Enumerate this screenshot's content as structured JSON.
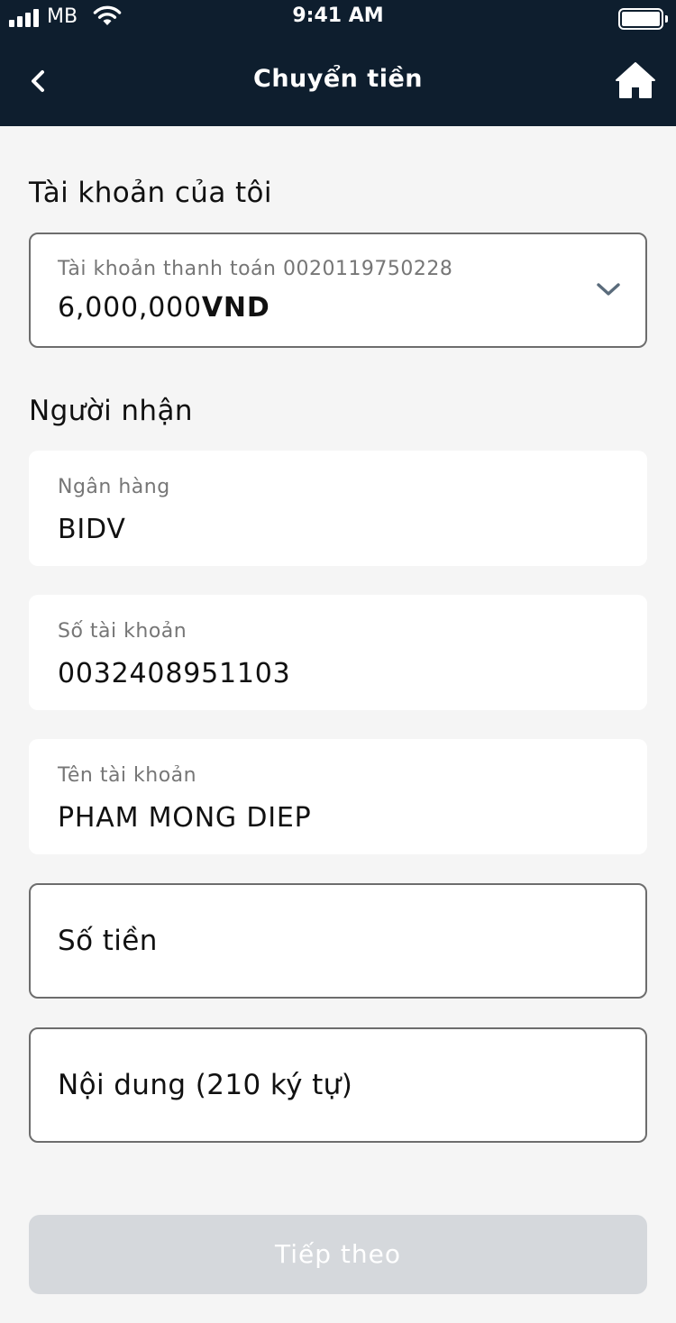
{
  "status_bar": {
    "carrier": "MB",
    "time": "9:41 AM"
  },
  "header": {
    "title": "Chuyển tiền",
    "back_icon": "chevron-left-icon",
    "home_icon": "home-icon"
  },
  "my_account": {
    "section_label": "Tài khoản của tôi",
    "account_label": "Tài khoản thanh toán 0020119750228",
    "balance_amount": "6,000,000",
    "balance_currency": "VND"
  },
  "recipient": {
    "section_label": "Người nhận",
    "bank": {
      "label": "Ngân hàng",
      "value": "BIDV"
    },
    "account_number": {
      "label": "Số tài khoản",
      "value": "0032408951103"
    },
    "account_name": {
      "label": "Tên tài khoản",
      "value": "PHAM MONG DIEP"
    },
    "amount": {
      "placeholder": "Số tiền"
    },
    "content": {
      "placeholder": "Nội dung (210 ký tự)"
    }
  },
  "actions": {
    "next_label": "Tiếp theo"
  },
  "colors": {
    "header_bg": "#0e1e2e",
    "page_bg": "#f5f5f5",
    "disabled_button": "#d5d8dc",
    "label_gray": "#767676"
  }
}
